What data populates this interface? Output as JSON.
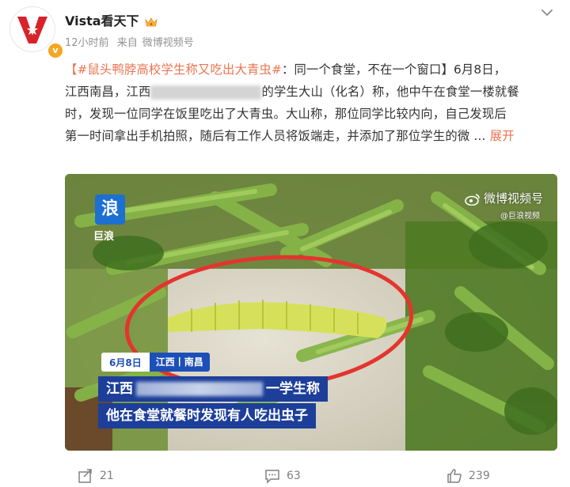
{
  "user": {
    "name": "Vista看天下",
    "time": "12小时前",
    "source_prefix": "来自",
    "source": "微博视频号"
  },
  "post": {
    "topic": "【#鼠头鸭脖高校学生称又吃出大青虫#",
    "line1_rest": "：同一个食堂，不在一个窗口】6月8日，",
    "line2a": "江西南昌，江西",
    "line2b": "的学生大山（化名）称，他中午在食堂一楼就餐",
    "line3": "时，发现一位同学在饭里吃出了大青虫。大山称，那位同学比较内向，自己发现后",
    "line4": "第一时间拿出手机拍照，随后有工作人员将饭端走，并添加了那位学生的微 ...",
    "expand_label": "展开"
  },
  "video": {
    "logo_char": "浪",
    "logo_text": "巨浪",
    "watermark": "微博视频号",
    "watermark_sub": "@巨浪视频",
    "date": "6月8日",
    "location": "江西丨南昌",
    "caption1_a": "江西",
    "caption1_b": "一学生称",
    "caption2": "他在食堂就餐时发现有人吃出虫子"
  },
  "footer": {
    "share_count": "21",
    "comment_count": "63",
    "like_count": "239"
  },
  "colors": {
    "accent": "#eb7350",
    "caption_bg": "#1d3f9a"
  }
}
